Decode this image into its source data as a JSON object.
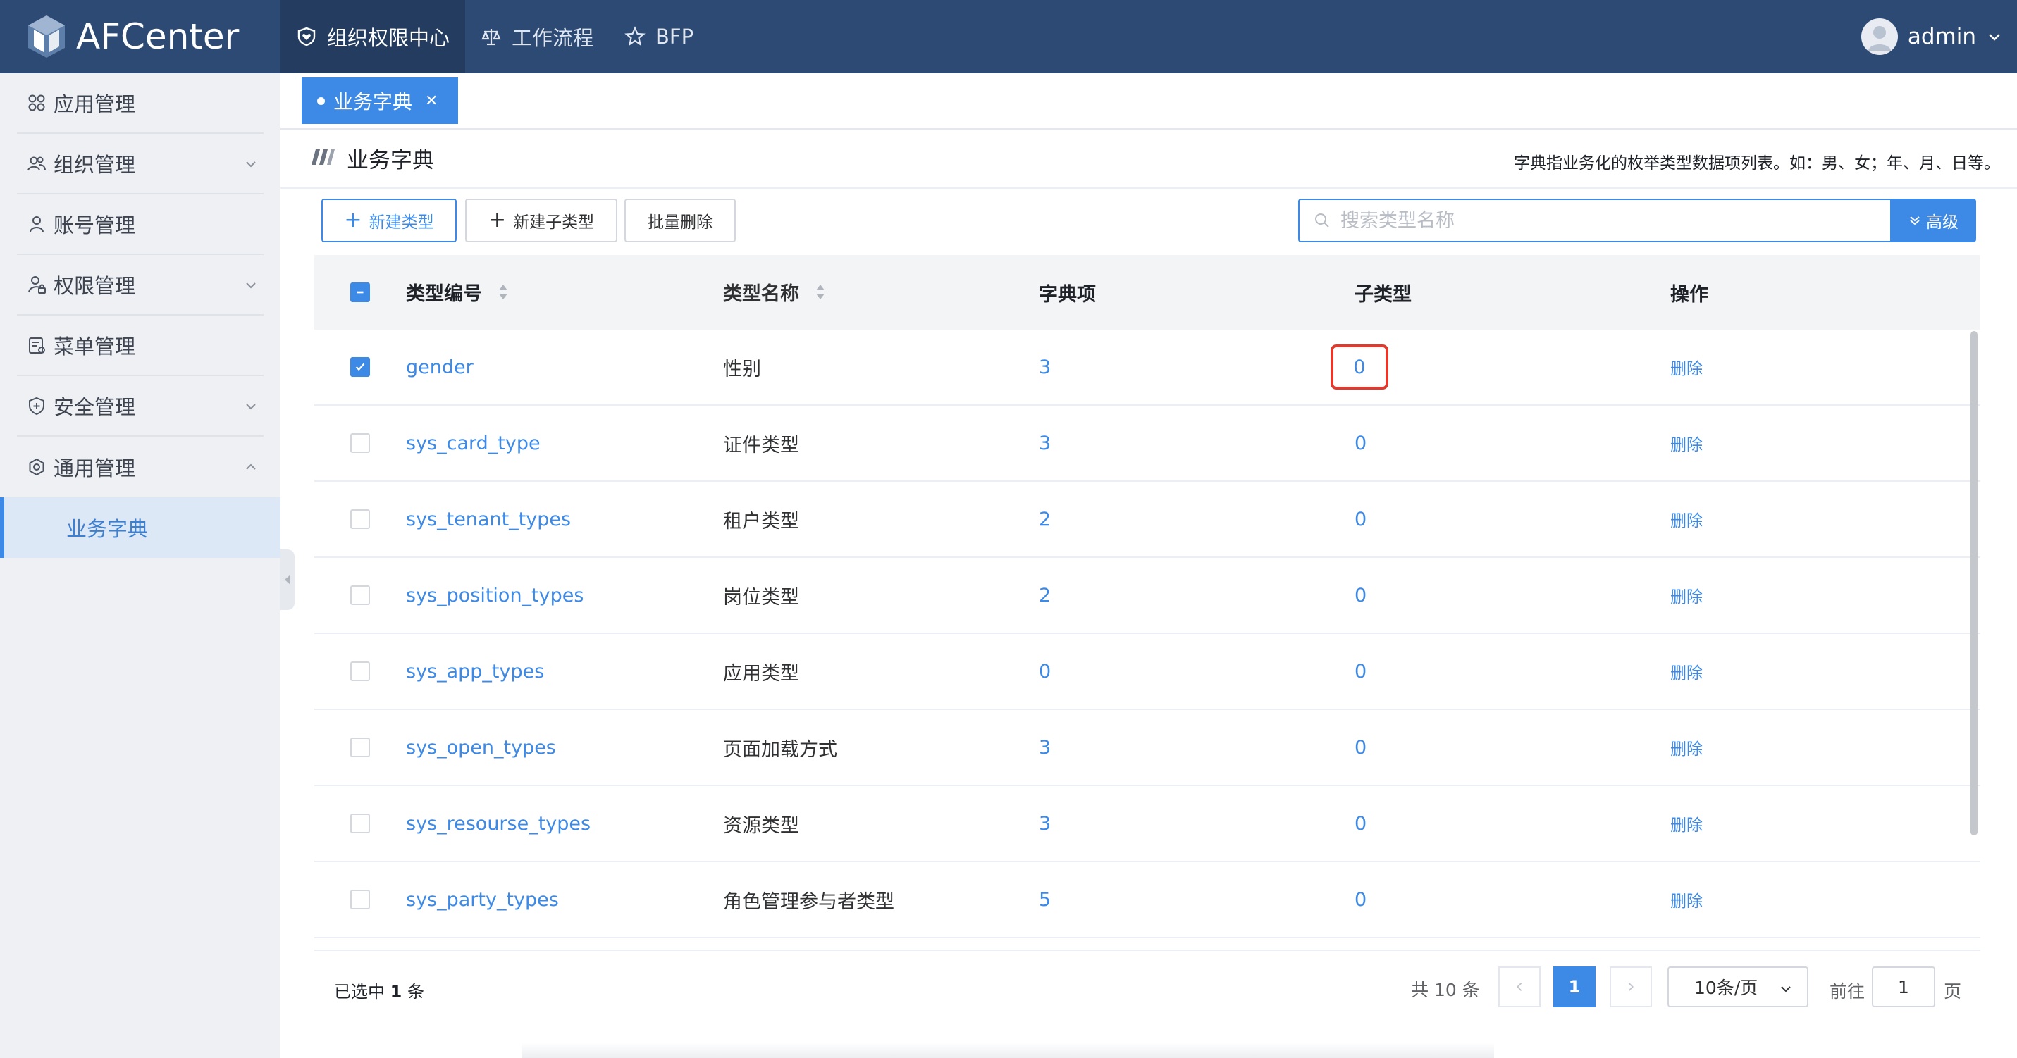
{
  "app": {
    "name": "AFCenter"
  },
  "topnav": {
    "items": [
      {
        "label": "组织权限中心",
        "icon": "shield-heart-icon",
        "active": true
      },
      {
        "label": "工作流程",
        "icon": "scale-icon",
        "active": false
      },
      {
        "label": "BFP",
        "icon": "star-icon",
        "active": false
      }
    ],
    "user": {
      "name": "admin"
    }
  },
  "sidebar": {
    "items": [
      {
        "label": "应用管理",
        "icon": "grid-icon",
        "expandable": false
      },
      {
        "label": "组织管理",
        "icon": "users-icon",
        "expandable": true
      },
      {
        "label": "账号管理",
        "icon": "user-icon",
        "expandable": false
      },
      {
        "label": "权限管理",
        "icon": "user-lock-icon",
        "expandable": true
      },
      {
        "label": "菜单管理",
        "icon": "menu-doc-icon",
        "expandable": false
      },
      {
        "label": "安全管理",
        "icon": "shield-plus-icon",
        "expandable": true
      },
      {
        "label": "通用管理",
        "icon": "settings-icon",
        "expandable": true,
        "expanded": true
      }
    ],
    "sub_active": "业务字典"
  },
  "tabs": [
    {
      "label": "业务字典",
      "active": true
    }
  ],
  "page": {
    "title": "业务字典",
    "description": "字典指业务化的枚举类型数据项列表。如：男、女；年、月、日等。"
  },
  "toolbar": {
    "new_type": "新建类型",
    "new_subtype": "新建子类型",
    "batch_delete": "批量删除",
    "search_placeholder": "搜索类型名称",
    "advanced": "高级"
  },
  "table": {
    "headers": {
      "code": "类型编号",
      "name": "类型名称",
      "items": "字典项",
      "subtypes": "子类型",
      "actions": "操作"
    },
    "rows": [
      {
        "code": "gender",
        "name": "性别",
        "items": "3",
        "subtypes": "0",
        "action": "删除",
        "checked": true,
        "highlight": true
      },
      {
        "code": "sys_card_type",
        "name": "证件类型",
        "items": "3",
        "subtypes": "0",
        "action": "删除",
        "checked": false
      },
      {
        "code": "sys_tenant_types",
        "name": "租户类型",
        "items": "2",
        "subtypes": "0",
        "action": "删除",
        "checked": false
      },
      {
        "code": "sys_position_types",
        "name": "岗位类型",
        "items": "2",
        "subtypes": "0",
        "action": "删除",
        "checked": false
      },
      {
        "code": "sys_app_types",
        "name": "应用类型",
        "items": "0",
        "subtypes": "0",
        "action": "删除",
        "checked": false
      },
      {
        "code": "sys_open_types",
        "name": "页面加载方式",
        "items": "3",
        "subtypes": "0",
        "action": "删除",
        "checked": false
      },
      {
        "code": "sys_resourse_types",
        "name": "资源类型",
        "items": "3",
        "subtypes": "0",
        "action": "删除",
        "checked": false
      },
      {
        "code": "sys_party_types",
        "name": "角色管理参与者类型",
        "items": "5",
        "subtypes": "0",
        "action": "删除",
        "checked": false
      }
    ]
  },
  "footer": {
    "selected_prefix": "已选中",
    "selected_count": "1",
    "selected_suffix": "条",
    "total": "共 10 条",
    "current_page": "1",
    "page_size": "10条/页",
    "goto_prefix": "前往",
    "goto_value": "1",
    "goto_suffix": "页"
  },
  "colors": {
    "header": "#2d4a74",
    "accent": "#3d8ae6",
    "highlight": "#e03a2e"
  }
}
